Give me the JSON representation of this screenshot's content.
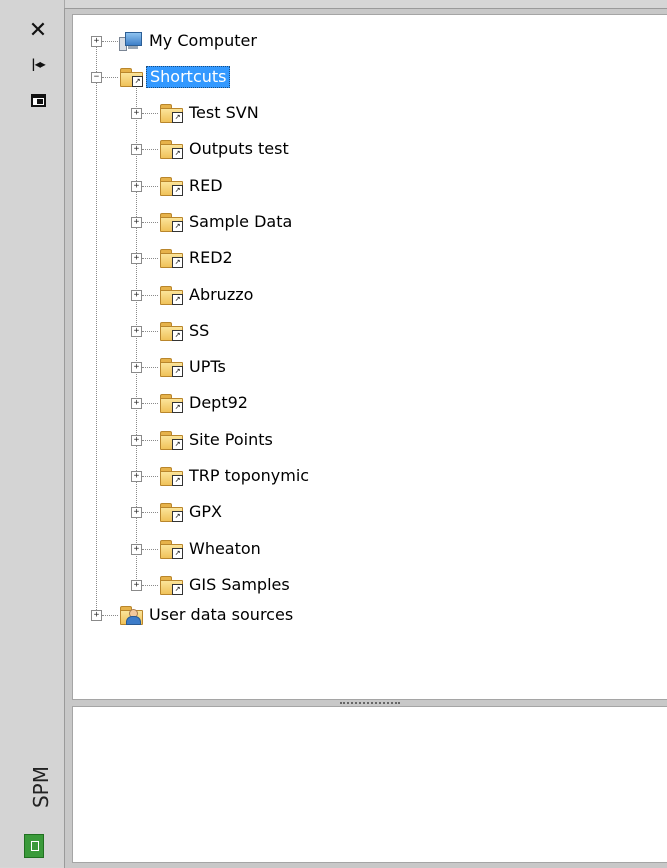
{
  "side_panel": {
    "close_icon": "close-icon",
    "autohide_icon": "arrows-icon",
    "properties_icon": "panel-icon",
    "title": "SPM",
    "status_icon": "file-status-icon"
  },
  "tree": {
    "my_computer": {
      "label": "My Computer",
      "icon": "computer-icon",
      "expanded": false
    },
    "shortcuts": {
      "label": "Shortcuts",
      "icon": "shortcut-folder-icon",
      "expanded": true,
      "selected": true
    },
    "shortcut_items": [
      {
        "label": "Test SVN"
      },
      {
        "label": "Outputs test"
      },
      {
        "label": "RED"
      },
      {
        "label": "Sample Data"
      },
      {
        "label": "RED2"
      },
      {
        "label": "Abruzzo"
      },
      {
        "label": "SS"
      },
      {
        "label": "UPTs"
      },
      {
        "label": "Dept92"
      },
      {
        "label": "Site Points"
      },
      {
        "label": "TRP toponymic"
      },
      {
        "label": "GPX"
      },
      {
        "label": "Wheaton"
      },
      {
        "label": "GIS Samples"
      }
    ],
    "user_data_sources": {
      "label": "User data sources",
      "icon": "user-folder-icon",
      "expanded": false
    }
  },
  "colors": {
    "selection": "#3399ff",
    "folder": "#f0c25a",
    "chrome": "#d6d6d6"
  }
}
